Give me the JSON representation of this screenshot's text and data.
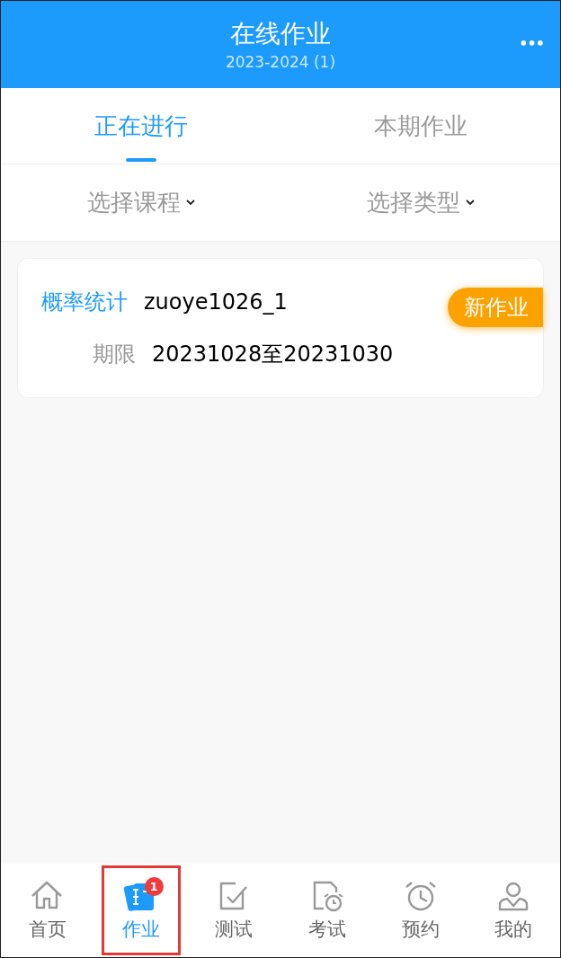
{
  "header": {
    "title": "在线作业",
    "subtitle": "2023-2024 (1)",
    "more": "•••"
  },
  "tabs": [
    {
      "label": "正在进行",
      "selected": true
    },
    {
      "label": "本期作业",
      "selected": false
    }
  ],
  "filters": [
    {
      "label": "选择课程"
    },
    {
      "label": "选择类型"
    }
  ],
  "assignments": [
    {
      "course": "概率统计",
      "name": "zuoye1026_1",
      "badge": "新作业",
      "deadline_label": "期限",
      "deadline": "20231028至20231030"
    }
  ],
  "nav": [
    {
      "kind": "home",
      "label": "首页",
      "selected": false,
      "highlighted": false
    },
    {
      "kind": "homework",
      "label": "作业",
      "selected": true,
      "highlighted": true,
      "count": "1"
    },
    {
      "kind": "test",
      "label": "测试",
      "selected": false,
      "highlighted": false
    },
    {
      "kind": "exam",
      "label": "考试",
      "selected": false,
      "highlighted": false
    },
    {
      "kind": "booking",
      "label": "预约",
      "selected": false,
      "highlighted": false
    },
    {
      "kind": "profile",
      "label": "我的",
      "selected": false,
      "highlighted": false
    }
  ]
}
